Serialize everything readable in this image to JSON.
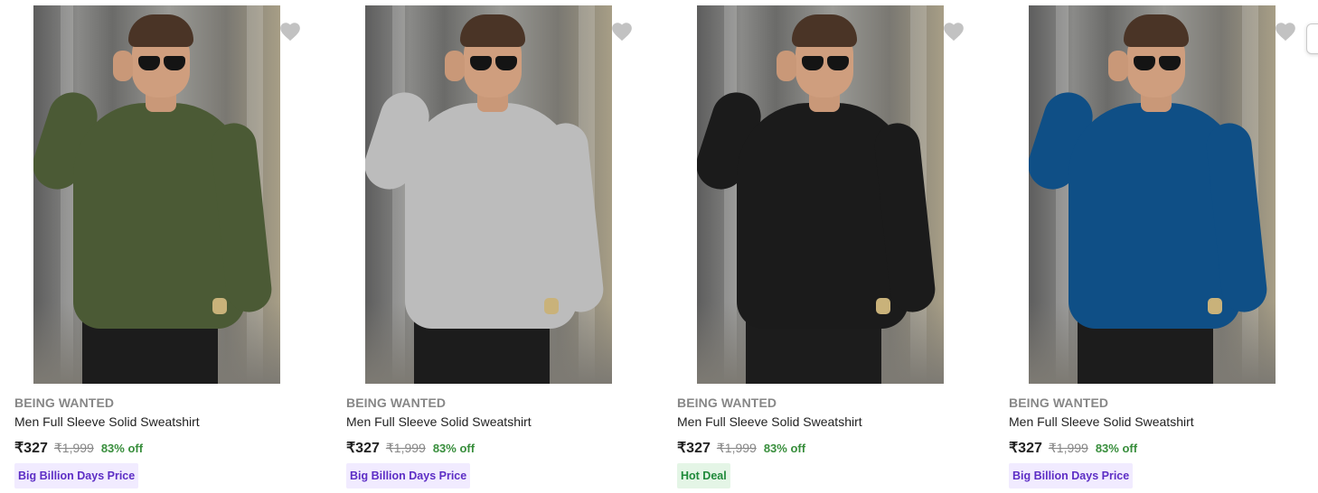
{
  "colors": {
    "brand_text": "#878787",
    "title_text": "#212121",
    "discount": "#388e3c",
    "badge_purple_bg": "#f1ebff",
    "badge_purple_text": "#5d2ec5",
    "badge_green_bg": "#e4f5e6",
    "badge_green_text": "#1f8a3a",
    "heart": "#c2c2c2"
  },
  "products": [
    {
      "brand": "BEING WANTED",
      "title": "Men Full Sleeve Solid Sweatshirt",
      "price": "₹327",
      "mrp": "₹1,999",
      "discount": "83% off",
      "badge": "Big Billion Days Price",
      "badge_style": "purple",
      "sweatshirt_color": "#4b5a35",
      "wishlist_icon": "heart-icon"
    },
    {
      "brand": "BEING WANTED",
      "title": "Men Full Sleeve Solid Sweatshirt",
      "price": "₹327",
      "mrp": "₹1,999",
      "discount": "83% off",
      "badge": "Big Billion Days Price",
      "badge_style": "purple",
      "sweatshirt_color": "#bcbcbc",
      "wishlist_icon": "heart-icon"
    },
    {
      "brand": "BEING WANTED",
      "title": "Men Full Sleeve Solid Sweatshirt",
      "price": "₹327",
      "mrp": "₹1,999",
      "discount": "83% off",
      "badge": "Hot Deal",
      "badge_style": "green",
      "sweatshirt_color": "#1b1b1b",
      "wishlist_icon": "heart-icon"
    },
    {
      "brand": "BEING WANTED",
      "title": "Men Full Sleeve Solid Sweatshirt",
      "price": "₹327",
      "mrp": "₹1,999",
      "discount": "83% off",
      "badge": "Big Billion Days Price",
      "badge_style": "purple",
      "sweatshirt_color": "#0f4f86",
      "wishlist_icon": "heart-icon"
    }
  ]
}
